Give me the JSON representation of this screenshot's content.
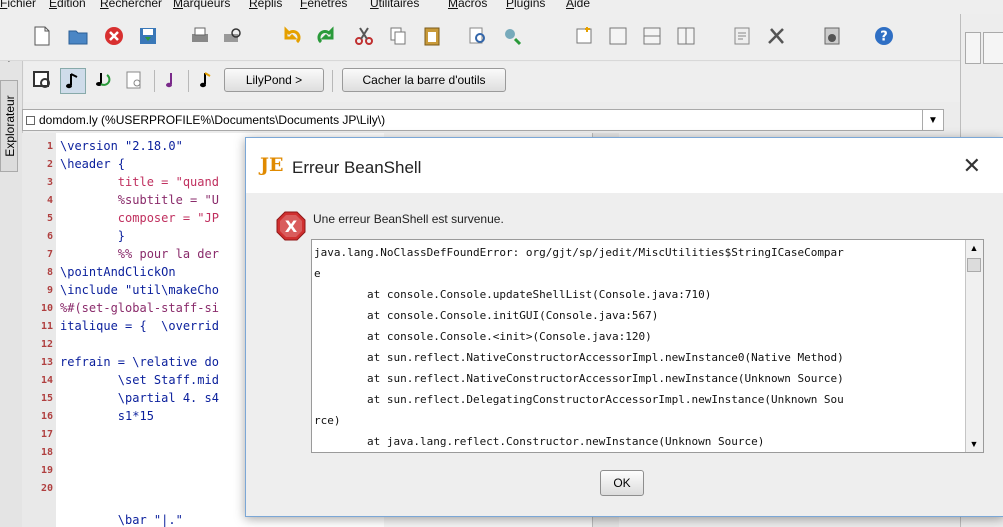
{
  "menu": [
    "Fichier",
    "Edition",
    "Rechercher",
    "Marqueurs",
    "Replis",
    "Fenetres",
    "Utilitaires",
    "Macros",
    "Plugins",
    "Aide"
  ],
  "toolbar2": {
    "lilypond_button": "LilyPond >",
    "hide_toolbar_button": "Cacher la barre d'outils"
  },
  "sidebar": {
    "explorer_tab": "Explorateur",
    "close_glyph": "x",
    "down_glyph": "▼"
  },
  "buffer": {
    "path": "domdom.ly (%USERPROFILE%\\Documents\\Documents JP\\Lily\\)",
    "dropdown_glyph": "▼"
  },
  "editor": {
    "line_numbers": [
      "1",
      "2",
      "3",
      "4",
      "5",
      "6",
      "7",
      "8",
      "9",
      "10",
      "11",
      "12",
      "13",
      "14",
      "15",
      "16",
      "17",
      "18",
      "19",
      "20"
    ],
    "lines": [
      "\\version \"2.18.0\"",
      "\\header {",
      "        title = \"quand",
      "        %subtitle = \"U",
      "        composer = \"JP",
      "        }",
      "        %% pour la der",
      "\\pointAndClickOn",
      "\\include \"util\\makeCho",
      "%#(set-global-staff-si",
      "italique = {  \\overrid",
      "",
      "refrain = \\relative do",
      "        \\set Staff.mid",
      "        \\partial 4. s4",
      "        s1*15",
      "",
      "",
      "",
      "        \\bar \"|.\""
    ]
  },
  "dialog": {
    "title": "Erreur BeanShell",
    "close_glyph": "✕",
    "message": "Une erreur BeanShell est survenue.",
    "trace": [
      "java.lang.NoClassDefFoundError: org/gjt/sp/jedit/MiscUtilities$StringICaseCompar",
      "e",
      "        at console.Console.updateShellList(Console.java:710)",
      "        at console.Console.initGUI(Console.java:567)",
      "        at console.Console.<init>(Console.java:120)",
      "        at sun.reflect.NativeConstructorAccessorImpl.newInstance0(Native Method)",
      "        at sun.reflect.NativeConstructorAccessorImpl.newInstance(Unknown Source)",
      "        at sun.reflect.DelegatingConstructorAccessorImpl.newInstance(Unknown Sou",
      "rce)",
      "        at java.lang.reflect.Constructor.newInstance(Unknown Source)"
    ],
    "scroll_up_glyph": "▲",
    "scroll_down_glyph": "▼",
    "ok_button": "OK"
  },
  "colors": {
    "accent": "#7ba7d6",
    "error_icon": "#d03030",
    "logo": "#e08a00"
  }
}
